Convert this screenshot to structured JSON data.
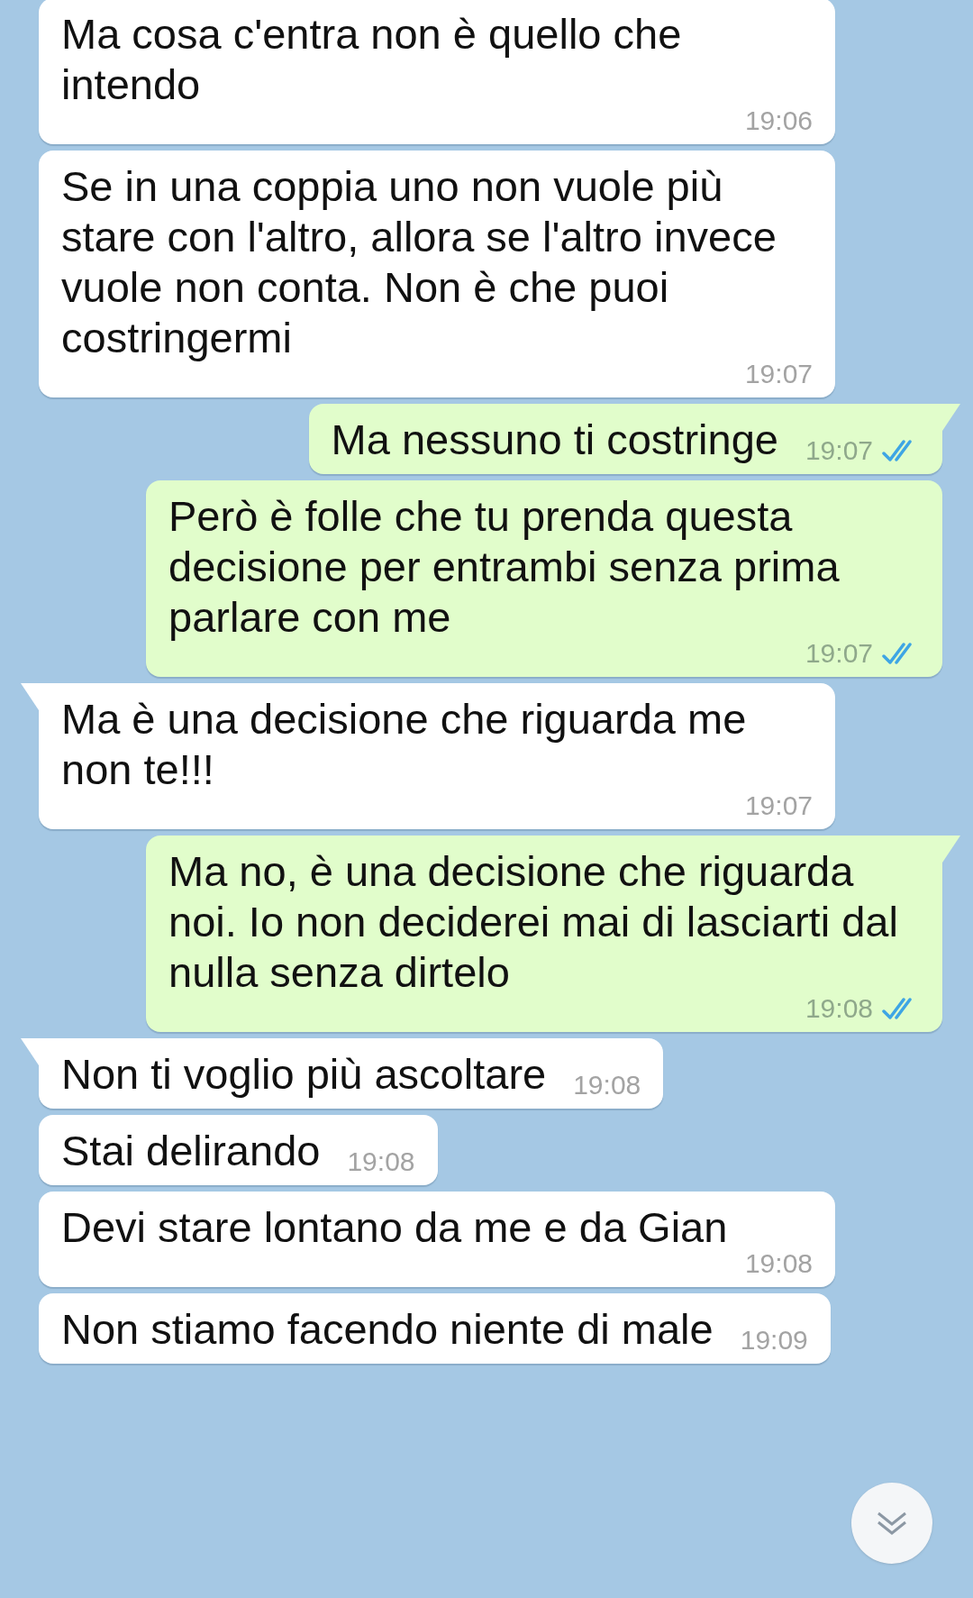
{
  "messages": [
    {
      "kind": "incoming",
      "tail": false,
      "text": "Ma cosa c'entra non è quello che intendo",
      "time": "19:06"
    },
    {
      "kind": "incoming",
      "tail": false,
      "text": "Se in una coppia uno non vuole più stare con l'altro, allora se l'altro invece vuole non conta. Non è che puoi costringermi",
      "time": "19:07"
    },
    {
      "kind": "outgoing",
      "tail": true,
      "text": "Ma nessuno ti costringe",
      "time": "19:07",
      "read": true
    },
    {
      "kind": "outgoing",
      "tail": false,
      "text": "Però è folle che tu prenda questa decisione per entrambi senza prima parlare con me",
      "time": "19:07",
      "read": true
    },
    {
      "kind": "incoming",
      "tail": true,
      "text": "Ma è una decisione che riguarda me non te!!!",
      "time": "19:07"
    },
    {
      "kind": "outgoing",
      "tail": true,
      "text": "Ma no, è una decisione che riguarda noi. Io non deciderei mai di lasciarti dal nulla senza dirtelo",
      "time": "19:08",
      "read": true
    },
    {
      "kind": "incoming",
      "tail": true,
      "text": "Non ti voglio più ascoltare",
      "time": "19:08"
    },
    {
      "kind": "incoming",
      "tail": false,
      "text": "Stai delirando",
      "time": "19:08"
    },
    {
      "kind": "incoming",
      "tail": false,
      "text": "Devi stare lontano da me e da Gian",
      "time": "19:08"
    },
    {
      "kind": "incoming",
      "tail": false,
      "text": "Non stiamo facendo niente di male",
      "time": "19:09"
    }
  ]
}
